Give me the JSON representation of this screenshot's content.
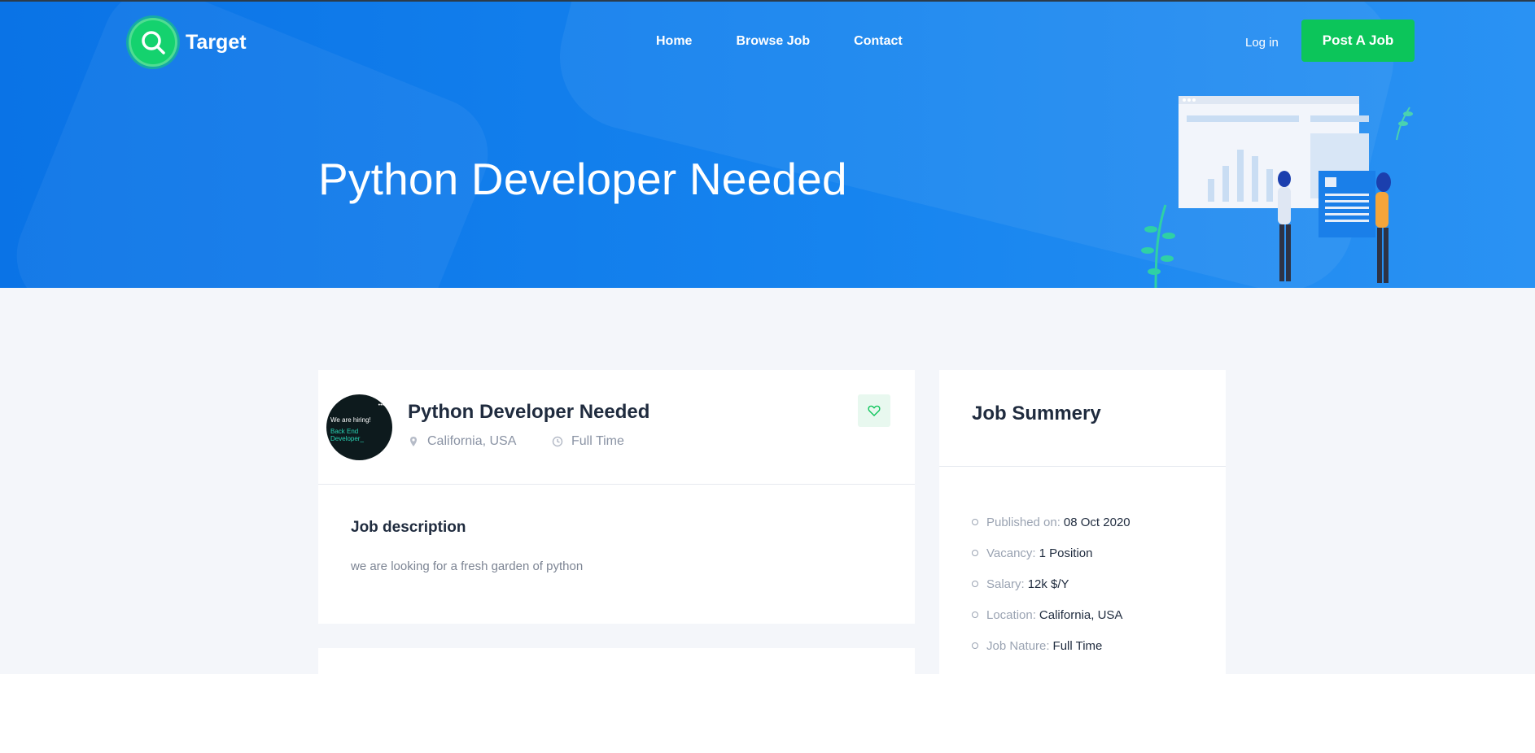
{
  "brand": {
    "name": "Target"
  },
  "nav": {
    "items": [
      "Home",
      "Browse Job",
      "Contact"
    ]
  },
  "header": {
    "login": "Log in",
    "post_job": "Post A Job"
  },
  "hero": {
    "title": "Python Developer Needed"
  },
  "job": {
    "title": "Python Developer Needed",
    "location": "California, USA",
    "type": "Full Time",
    "avatar_line1": "We are hiring!",
    "avatar_line2": "Back End Developer_",
    "description_heading": "Job description",
    "description_text": "we are looking for a fresh garden of python"
  },
  "summary": {
    "title": "Job Summery",
    "items": [
      {
        "label": "Published on:",
        "value": "08 Oct 2020"
      },
      {
        "label": "Vacancy:",
        "value": "1 Position"
      },
      {
        "label": "Salary:",
        "value": "12k $/Y"
      },
      {
        "label": "Location:",
        "value": "California, USA"
      },
      {
        "label": "Job Nature:",
        "value": "Full Time"
      }
    ]
  },
  "colors": {
    "primary": "#0a73e6",
    "accent_green": "#0cc55a",
    "page_bg": "#f4f6fa"
  },
  "icons": [
    "search-logo-icon",
    "map-marker-icon",
    "clock-icon",
    "heart-icon"
  ]
}
